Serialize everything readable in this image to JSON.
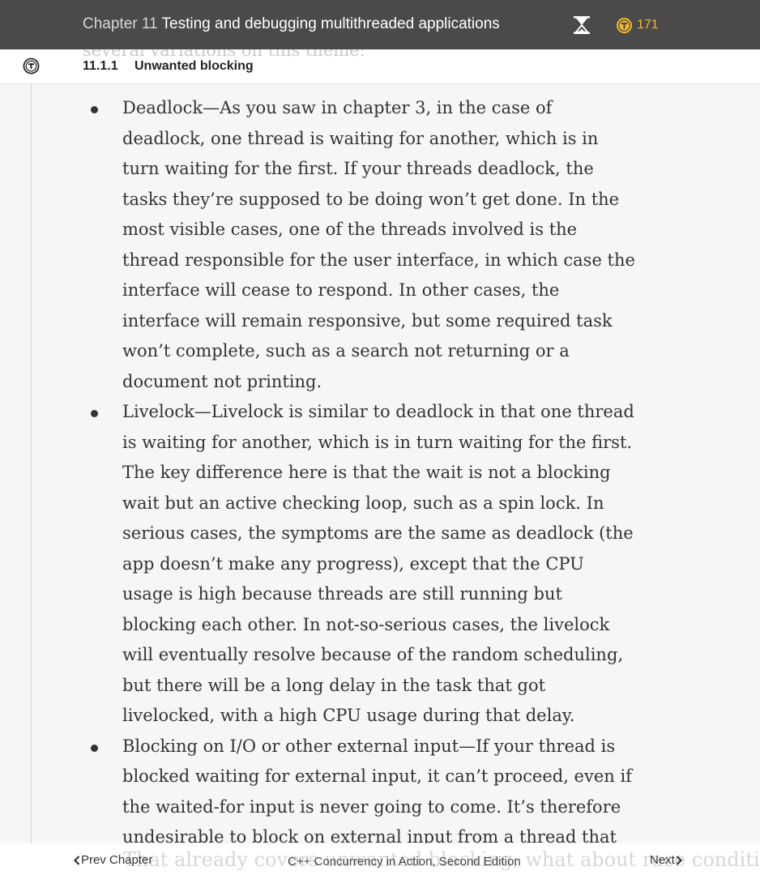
{
  "header": {
    "chapter_number": "Chapter 11",
    "chapter_title": "Testing and debugging multithreaded applications",
    "token_count": "171",
    "accent_color": "#f5b82e",
    "bar_color": "#4a4a4a"
  },
  "section": {
    "number": "11.1.1",
    "title": "Unwanted blocking",
    "scrolled_text": "several variations on this theme:"
  },
  "items": [
    {
      "text": "Deadlock—As you saw in chapter 3, in the case of deadlock, one thread is waiting for another, which is in turn waiting for the first. If your threads deadlock, the tasks they’re supposed to be doing won’t get done. In the most visible cases, one of the threads involved is the thread responsible for the user interface, in which case the interface will cease to respond. In other cases, the interface will remain responsive, but some required task won’t complete, such as a search not returning or a document not printing."
    },
    {
      "text": "Livelock—Livelock is similar to deadlock in that one thread is waiting for another, which is in turn waiting for the first. The key difference here is that the wait is not a blocking wait but an active checking loop, such as a spin lock. In serious cases, the symptoms are the same as deadlock (the app doesn’t make any progress), except that the CPU usage is high because threads are still running but blocking each other. In not-so-serious cases, the livelock will eventually resolve because of the random scheduling, but there will be a long delay in the task that got livelocked, with a high CPU usage during that delay."
    },
    {
      "text": "Blocking on I/O or other external input—If your thread is blocked waiting for external input, it can’t proceed, even if the waited-for input is never going to come. It’s therefore undesirable to block on external input from a thread that also performs tasks that other threads may be waiting for."
    }
  ],
  "footer": {
    "prev_label": "Prev Chapter",
    "book_title": "C++ Concurrency in Action, Second Edition",
    "next_label": "Next",
    "scrolled_text": "That already covers unwanted blocking; what about race conditions?"
  }
}
